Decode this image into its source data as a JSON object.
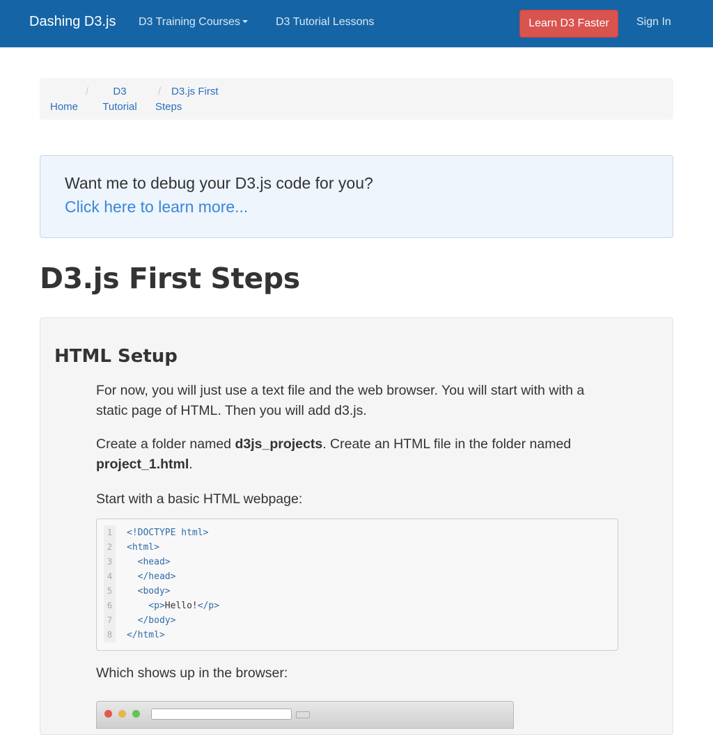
{
  "navbar": {
    "brand": "Dashing D3.js",
    "courses": "D3 Training Courses",
    "lessons": "D3 Tutorial Lessons",
    "cta": "Learn D3 Faster",
    "signin": "Sign In"
  },
  "breadcrumb": {
    "home": "Home",
    "tutorial_line1": "D3",
    "tutorial_line2": "Tutorial",
    "steps_line1": "D3.js First",
    "steps_line2": "Steps",
    "separator": "/"
  },
  "promo": {
    "question": "Want me to debug your D3.js code for you?",
    "link": "Click here to learn more..."
  },
  "page_title": "D3.js First Steps",
  "section": {
    "title": "HTML Setup",
    "p1": "For now, you will just use a text file and the web browser. You will start with with a static page of HTML. Then you will add d3.js.",
    "p2_before": "Create a folder named ",
    "p2_folder": "d3js_projects",
    "p2_middle": ". Create an HTML file in the folder named ",
    "p2_file": "project_1.html",
    "p2_after": ".",
    "p3": "Start with a basic HTML webpage:",
    "p4": "Which shows up in the browser:"
  },
  "code": [
    {
      "n": "1",
      "text": "<!DOCTYPE html>"
    },
    {
      "n": "2",
      "text": "<html>"
    },
    {
      "n": "3",
      "text": "  <head>"
    },
    {
      "n": "4",
      "text": "  </head>"
    },
    {
      "n": "5",
      "text": "  <body>"
    },
    {
      "n": "6",
      "text": "    <p>Hello!</p>"
    },
    {
      "n": "7",
      "text": "  </body>"
    },
    {
      "n": "8",
      "text": "</html>"
    }
  ],
  "colors": {
    "navbar": "#1565a6",
    "cta": "#d9534f",
    "link": "#2a6fbd"
  }
}
